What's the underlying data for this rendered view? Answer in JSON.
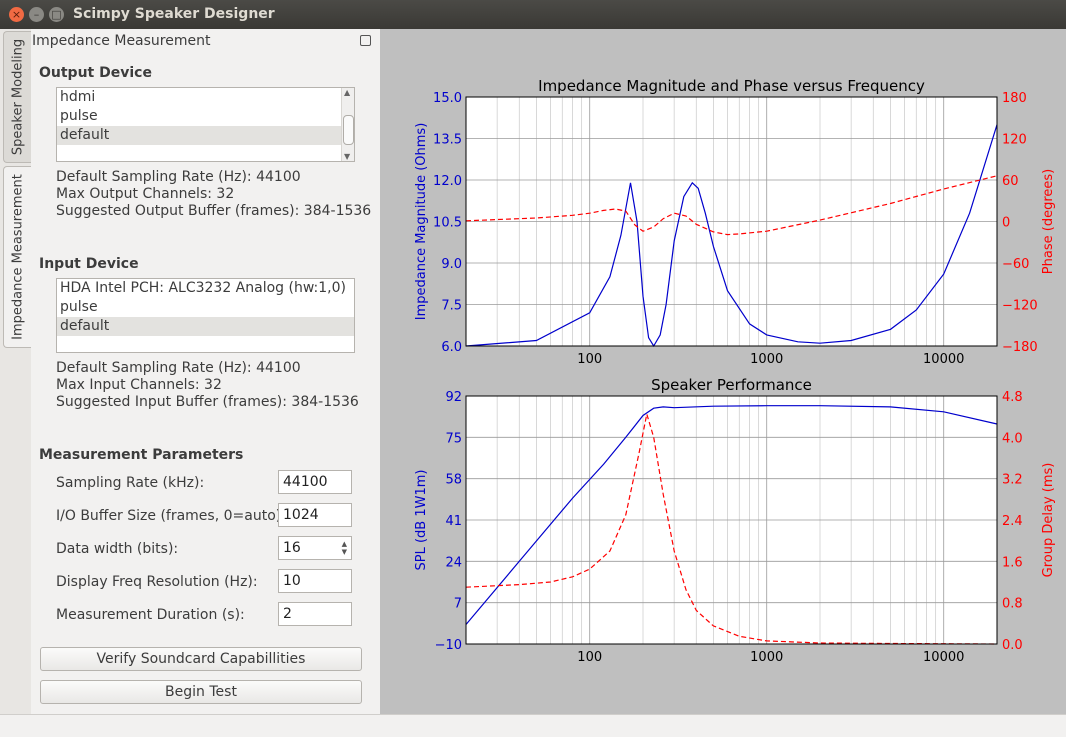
{
  "window": {
    "title": "Scimpy Speaker Designer",
    "close_glyph": "×",
    "min_glyph": "–",
    "max_glyph": "□"
  },
  "tabs": [
    {
      "label": "Speaker Modeling"
    },
    {
      "label": "Impedance Measurement"
    }
  ],
  "dock": {
    "title": "Impedance Measurement"
  },
  "output": {
    "section": "Output Device",
    "devices": [
      "hdmi",
      "pulse",
      "default"
    ],
    "selected_index": 2,
    "sampling": "Default Sampling Rate (Hz): 44100",
    "channels": "Max Output Channels: 32",
    "buffer": "Suggested Output Buffer (frames): 384-1536"
  },
  "input": {
    "section": "Input Device",
    "devices": [
      "HDA Intel PCH: ALC3232 Analog (hw:1,0)",
      "pulse",
      "default"
    ],
    "selected_index": 2,
    "sampling": "Default Sampling Rate (Hz): 44100",
    "channels": "Max Input Channels: 32",
    "buffer": "Suggested Input Buffer (frames): 384-1536"
  },
  "params": {
    "section": "Measurement Parameters",
    "sampling_label": "Sampling Rate (kHz):",
    "sampling_value": "44100",
    "buffer_label": "I/O Buffer Size (frames, 0=auto):",
    "buffer_value": "1024",
    "width_label": "Data width (bits):",
    "width_value": "16",
    "res_label": "Display Freq Resolution (Hz):",
    "res_value": "10",
    "duration_label": "Measurement Duration (s):",
    "duration_value": "2"
  },
  "buttons": {
    "verify": "Verify Soundcard Capabillities",
    "begin": "Begin Test"
  },
  "colors": {
    "left_axis": "#0000cc",
    "right_axis": "#ff0000",
    "plot_bg": "#bfbfbf"
  },
  "chart_data": [
    {
      "type": "line",
      "title": "Impedance Magnitude and Phase versus Frequency",
      "xscale": "log",
      "xlim": [
        20,
        20000
      ],
      "xticks": [
        "100",
        "1000",
        "10000"
      ],
      "ylabel": "Impedance Magnitude (Ohms)",
      "ylim": [
        6.0,
        15.0
      ],
      "yticks": [
        "6.0",
        "7.5",
        "9.0",
        "10.5",
        "12.0",
        "13.5",
        "15.0"
      ],
      "y2label": "Phase (degrees)",
      "y2lim": [
        -180,
        180
      ],
      "y2ticks": [
        "−180",
        "−120",
        "−60",
        "0",
        "60",
        "120",
        "180"
      ],
      "grid": true,
      "series": [
        {
          "axis": "left",
          "style": "solid",
          "color": "#0000cc",
          "x": [
            20,
            50,
            100,
            130,
            150,
            170,
            185,
            200,
            215,
            230,
            250,
            270,
            300,
            340,
            380,
            410,
            450,
            500,
            600,
            800,
            1000,
            1500,
            2000,
            3000,
            5000,
            7000,
            10000,
            14000,
            20000
          ],
          "y": [
            6.0,
            6.2,
            7.2,
            8.5,
            10.0,
            11.9,
            10.5,
            7.8,
            6.3,
            6.0,
            6.4,
            7.5,
            9.8,
            11.4,
            11.9,
            11.7,
            10.8,
            9.6,
            8.0,
            6.8,
            6.4,
            6.15,
            6.1,
            6.2,
            6.6,
            7.3,
            8.6,
            10.8,
            14.0
          ]
        },
        {
          "axis": "right",
          "style": "dashed",
          "color": "#ff0000",
          "x": [
            20,
            50,
            80,
            100,
            120,
            140,
            160,
            180,
            200,
            230,
            260,
            300,
            350,
            400,
            500,
            600,
            700,
            1000,
            2000,
            5000,
            10000,
            20000
          ],
          "y": [
            1,
            5,
            9,
            12,
            16,
            18,
            15,
            -5,
            -14,
            -8,
            4,
            12,
            8,
            -4,
            -15,
            -19,
            -18,
            -14,
            2,
            26,
            47,
            66
          ]
        }
      ]
    },
    {
      "type": "line",
      "title": "Speaker Performance",
      "xscale": "log",
      "xlim": [
        20,
        20000
      ],
      "xticks": [
        "100",
        "1000",
        "10000"
      ],
      "ylabel": "SPL (dB 1W1m)",
      "ylim": [
        -10,
        92
      ],
      "yticks": [
        "−10",
        "7",
        "24",
        "41",
        "58",
        "75",
        "92"
      ],
      "y2label": "Group Delay (ms)",
      "y2lim": [
        0.0,
        4.8
      ],
      "y2ticks": [
        "0.0",
        "0.8",
        "1.6",
        "2.4",
        "3.2",
        "4.0",
        "4.8"
      ],
      "grid": true,
      "series": [
        {
          "axis": "left",
          "style": "solid",
          "color": "#0000cc",
          "x": [
            20,
            40,
            80,
            120,
            160,
            200,
            230,
            260,
            300,
            500,
            1000,
            2000,
            5000,
            10000,
            20000
          ],
          "y": [
            -2,
            24,
            50,
            64,
            75,
            84,
            87,
            87.5,
            87.2,
            87.8,
            88,
            88,
            87.5,
            85.5,
            80.5
          ]
        },
        {
          "axis": "right",
          "style": "dashed",
          "color": "#ff0000",
          "x": [
            20,
            40,
            60,
            80,
            100,
            130,
            160,
            190,
            210,
            230,
            260,
            300,
            350,
            400,
            500,
            700,
            1000,
            2000,
            5000,
            20000
          ],
          "y": [
            1.1,
            1.15,
            1.2,
            1.3,
            1.45,
            1.8,
            2.5,
            3.7,
            4.45,
            4.0,
            2.9,
            1.8,
            1.05,
            0.65,
            0.35,
            0.15,
            0.06,
            0.02,
            0.01,
            0.0
          ]
        }
      ]
    }
  ]
}
